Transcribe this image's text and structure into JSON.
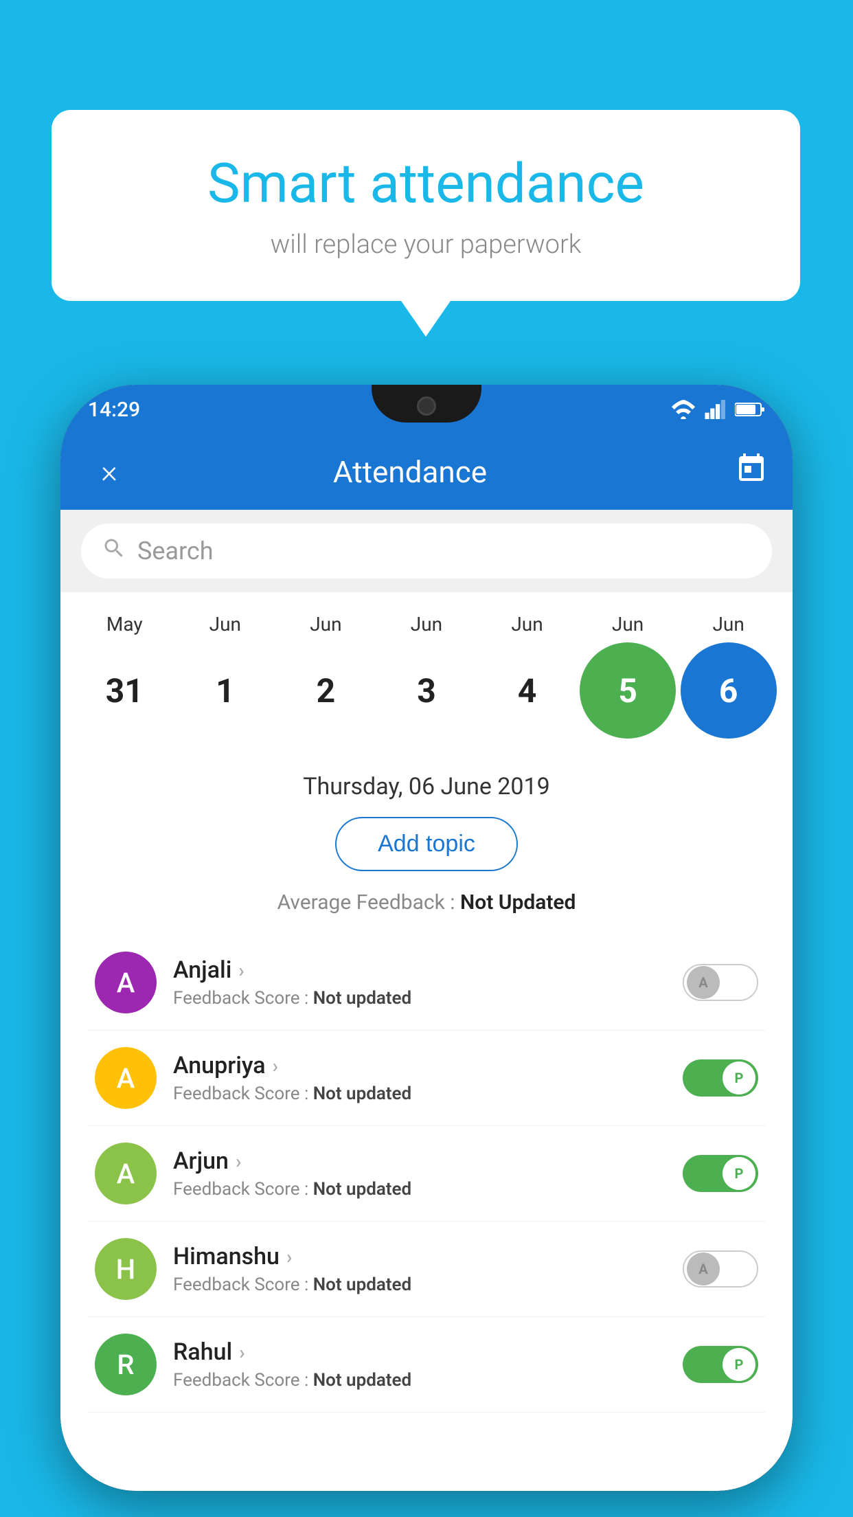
{
  "background_color": "#1ab8e8",
  "speech_bubble": {
    "title": "Smart attendance",
    "subtitle": "will replace your paperwork"
  },
  "status_bar": {
    "time": "14:29"
  },
  "app_bar": {
    "title": "Attendance",
    "close_label": "×",
    "calendar_icon": "📅"
  },
  "search": {
    "placeholder": "Search"
  },
  "calendar": {
    "columns": [
      {
        "month": "May",
        "date": "31",
        "type": "normal"
      },
      {
        "month": "Jun",
        "date": "1",
        "type": "normal"
      },
      {
        "month": "Jun",
        "date": "2",
        "type": "normal"
      },
      {
        "month": "Jun",
        "date": "3",
        "type": "normal"
      },
      {
        "month": "Jun",
        "date": "4",
        "type": "normal"
      },
      {
        "month": "Jun",
        "date": "5",
        "type": "green"
      },
      {
        "month": "Jun",
        "date": "6",
        "type": "blue"
      }
    ]
  },
  "selected_date": "Thursday, 06 June 2019",
  "add_topic_label": "Add topic",
  "average_feedback_label": "Average Feedback :",
  "average_feedback_value": "Not Updated",
  "students": [
    {
      "name": "Anjali",
      "initial": "A",
      "avatar_color": "#9c27b0",
      "feedback_label": "Feedback Score :",
      "feedback_value": "Not updated",
      "toggle_state": "off",
      "toggle_label": "A"
    },
    {
      "name": "Anupriya",
      "initial": "A",
      "avatar_color": "#ffc107",
      "feedback_label": "Feedback Score :",
      "feedback_value": "Not updated",
      "toggle_state": "on",
      "toggle_label": "P"
    },
    {
      "name": "Arjun",
      "initial": "A",
      "avatar_color": "#8bc34a",
      "feedback_label": "Feedback Score :",
      "feedback_value": "Not updated",
      "toggle_state": "on",
      "toggle_label": "P"
    },
    {
      "name": "Himanshu",
      "initial": "H",
      "avatar_color": "#8bc34a",
      "feedback_label": "Feedback Score :",
      "feedback_value": "Not updated",
      "toggle_state": "off",
      "toggle_label": "A"
    },
    {
      "name": "Rahul",
      "initial": "R",
      "avatar_color": "#4caf50",
      "feedback_label": "Feedback Score :",
      "feedback_value": "Not updated",
      "toggle_state": "on",
      "toggle_label": "P"
    }
  ]
}
